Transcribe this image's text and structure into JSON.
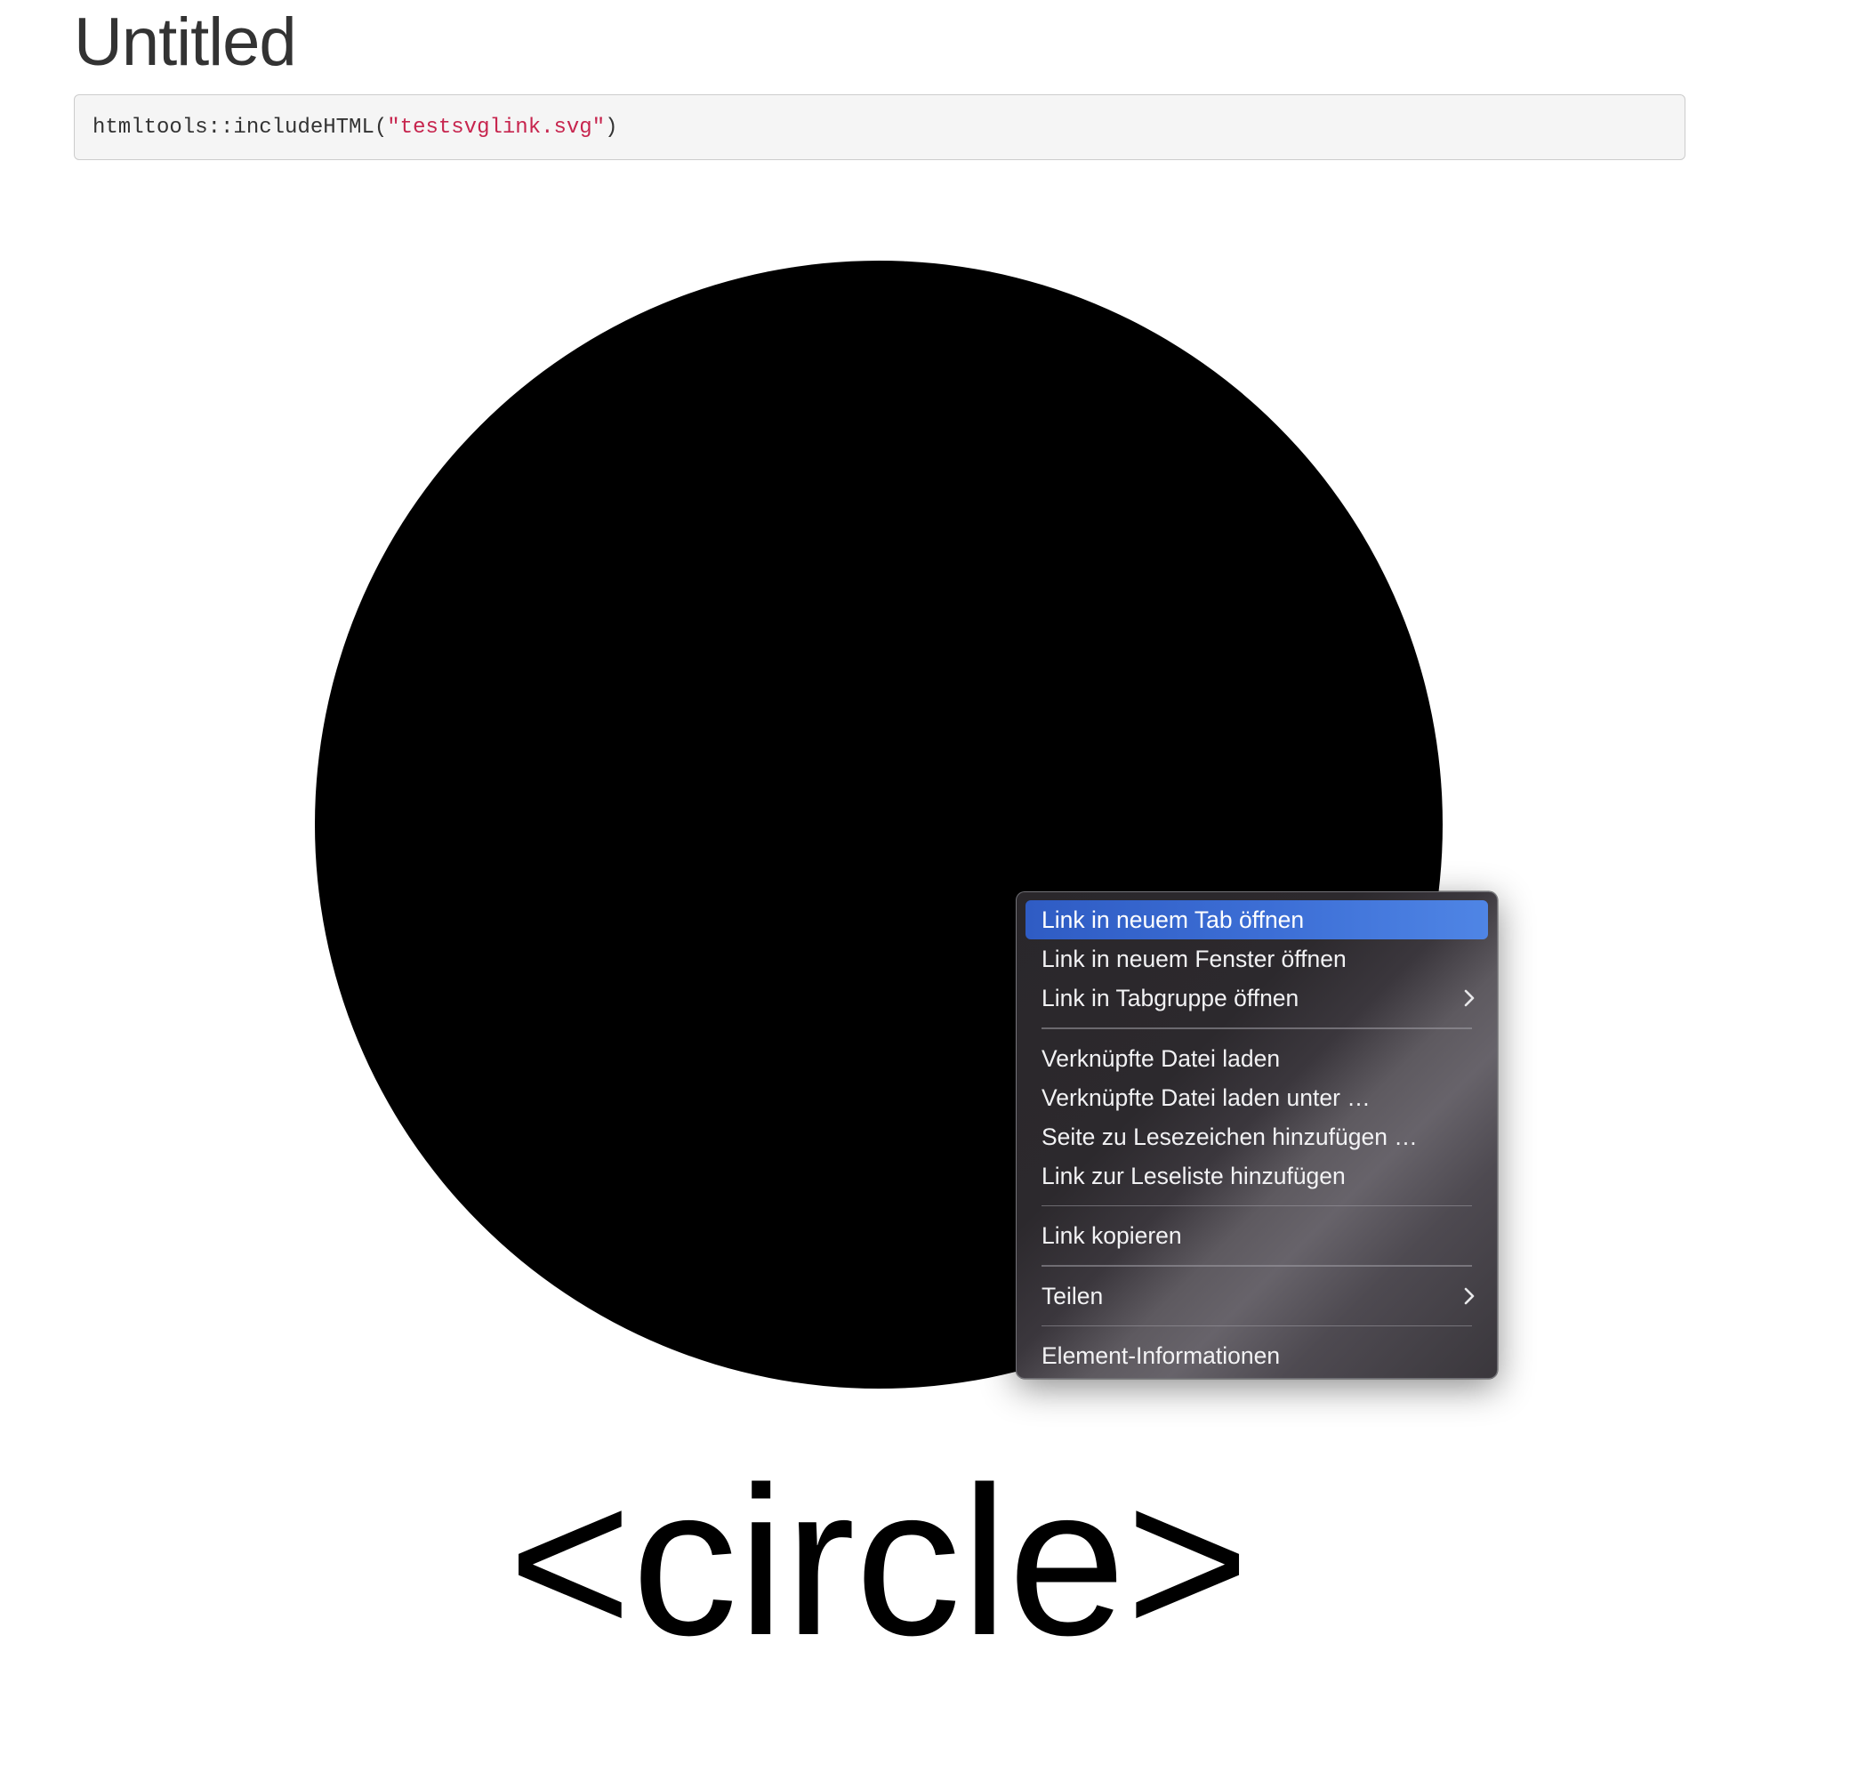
{
  "page": {
    "title": "Untitled"
  },
  "code": {
    "prefix": "htmltools::includeHTML(",
    "string": "\"testsvglink.svg\"",
    "suffix": ")"
  },
  "figure": {
    "shape": "circle",
    "fill": "#000000",
    "label": "<circle>"
  },
  "context_menu": {
    "groups": [
      {
        "items": [
          {
            "label": "Link in neuem Tab öffnen",
            "highlighted": true,
            "submenu": false
          },
          {
            "label": "Link in neuem Fenster öffnen",
            "highlighted": false,
            "submenu": false
          },
          {
            "label": "Link in Tabgruppe öffnen",
            "highlighted": false,
            "submenu": true
          }
        ]
      },
      {
        "items": [
          {
            "label": "Verknüpfte Datei laden",
            "highlighted": false,
            "submenu": false
          },
          {
            "label": "Verknüpfte Datei laden unter …",
            "highlighted": false,
            "submenu": false
          },
          {
            "label": "Seite zu Lesezeichen hinzufügen …",
            "highlighted": false,
            "submenu": false
          },
          {
            "label": "Link zur Leseliste hinzufügen",
            "highlighted": false,
            "submenu": false
          }
        ]
      },
      {
        "items": [
          {
            "label": "Link kopieren",
            "highlighted": false,
            "submenu": false
          }
        ]
      },
      {
        "items": [
          {
            "label": "Teilen",
            "highlighted": false,
            "submenu": true
          }
        ]
      },
      {
        "items": [
          {
            "label": "Element-Informationen",
            "highlighted": false,
            "submenu": false
          }
        ]
      }
    ],
    "chevron_icon": "chevron-right-icon",
    "highlight_color": "#3d6fd6"
  }
}
